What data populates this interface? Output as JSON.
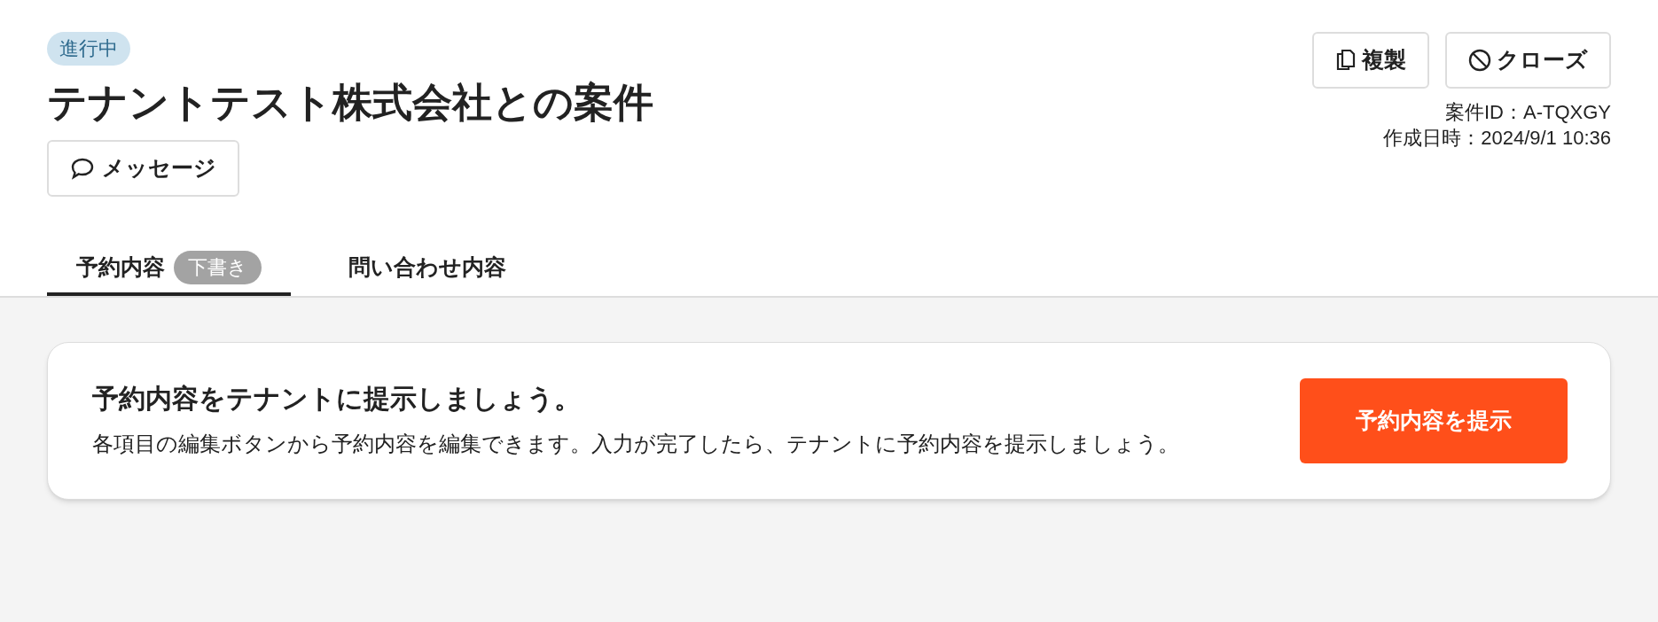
{
  "header": {
    "status_badge": "進行中",
    "title": "テナントテスト株式会社との案件",
    "message_button": "メッセージ",
    "actions": [
      {
        "kind": "copy",
        "label": "複製"
      },
      {
        "kind": "close",
        "label": "クローズ"
      }
    ],
    "meta": [
      "案件ID：A-TQXGY",
      "作成日時：2024/9/1 10:36"
    ]
  },
  "tabs": [
    {
      "label": "予約内容",
      "badge": "下書き",
      "selected": true
    },
    {
      "label": "問い合わせ内容",
      "selected": false
    }
  ],
  "card": {
    "title": "予約内容をテナントに提示しましょう。",
    "body": "各項目の編集ボタンから予約内容を編集できます。入力が完了したら、テナントに予約内容を提示しましょう。",
    "button": "予約内容を提示"
  }
}
